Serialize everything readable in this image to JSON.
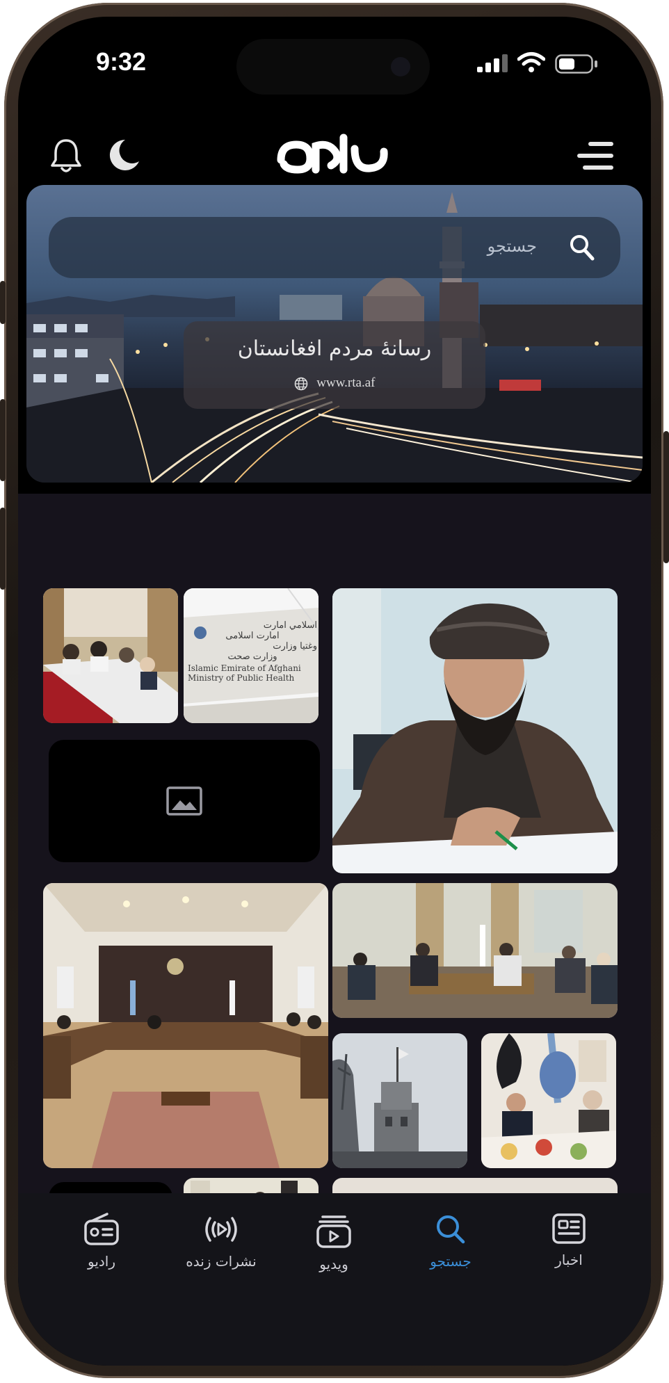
{
  "status_bar": {
    "time": "9:32"
  },
  "search": {
    "placeholder": "جستجو"
  },
  "hero": {
    "title": "رسانهٔ مردم افغانستان",
    "url": "www.rta.af"
  },
  "gallery": {
    "sign_lines": [
      "امارت اسلامی",
      "اسلامي امارت",
      "وزارت صحت",
      "وغتيا وزارت",
      "Islamic Emirate of Afghani",
      "Ministry of Public Health"
    ]
  },
  "tabs": [
    {
      "id": "radio",
      "label": "رادیو",
      "icon": "radio-icon",
      "active": false
    },
    {
      "id": "live",
      "label": "نشرات زنده",
      "icon": "live-broadcast-icon",
      "active": false
    },
    {
      "id": "video",
      "label": "ویدیو",
      "icon": "video-icon",
      "active": false
    },
    {
      "id": "search",
      "label": "جستجو",
      "icon": "search-icon",
      "active": true
    },
    {
      "id": "news",
      "label": "اخبار",
      "icon": "news-icon",
      "active": false
    }
  ],
  "colors": {
    "active_tab": "#3b8fd8",
    "background": "#16131c",
    "tab_bar": "#141419"
  }
}
